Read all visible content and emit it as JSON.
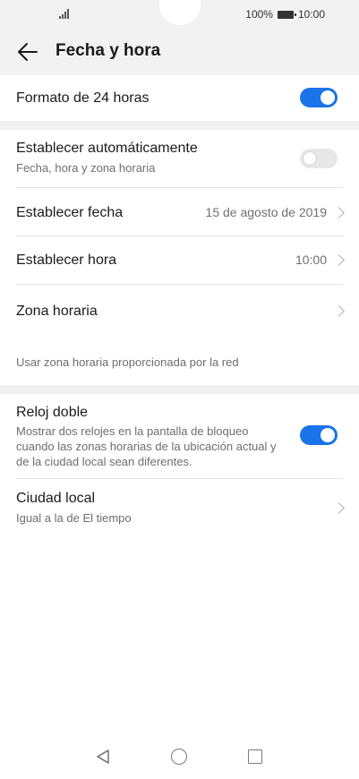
{
  "status_bar": {
    "battery_text": "100%",
    "time": "10:00"
  },
  "header": {
    "title": "Fecha y hora"
  },
  "settings": {
    "format24": {
      "label": "Formato de 24 horas",
      "enabled": true
    },
    "auto": {
      "label": "Establecer automáticamente",
      "sub": "Fecha, hora y zona horaria",
      "enabled": false
    },
    "date": {
      "label": "Establecer fecha",
      "value": "15 de agosto de 2019"
    },
    "time": {
      "label": "Establecer hora",
      "value": "10:00"
    },
    "timezone": {
      "label": "Zona horaria"
    },
    "network_hint": "Usar zona horaria proporcionada por la red",
    "dual_clock": {
      "label": "Reloj doble",
      "sub": "Mostrar dos relojes en la pantalla de bloqueo cuando las zonas horarias de la ubicación actual y de la ciudad local sean diferentes.",
      "enabled": true
    },
    "home_city": {
      "label": "Ciudad local",
      "sub": "Igual a la de El tiempo"
    }
  },
  "icons": {
    "back": "arrow-left-icon",
    "chevron": "chevron-right-icon",
    "nav_back": "triangle-back-icon",
    "nav_home": "circle-home-icon",
    "nav_recent": "square-recent-icon"
  },
  "colors": {
    "accent": "#1a73e8",
    "toggle_off": "#e8e8e8",
    "header_bg": "#f2f2f2"
  }
}
